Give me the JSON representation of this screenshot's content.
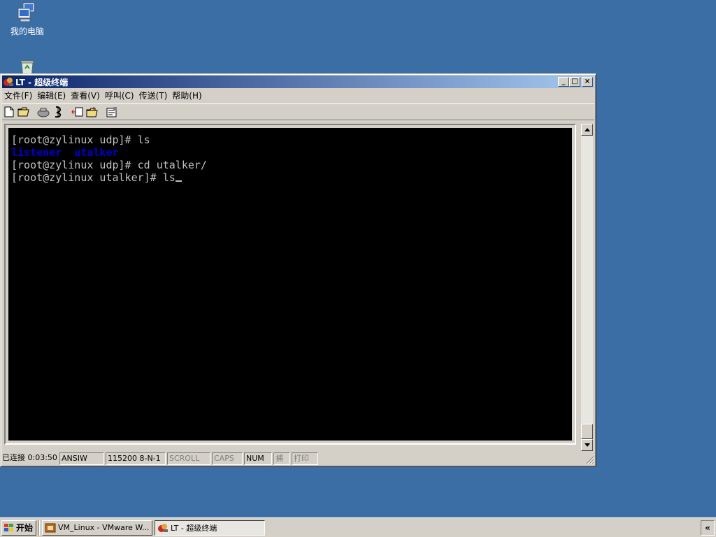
{
  "desktop": {
    "icons": [
      {
        "label": "我的电脑",
        "icon": "my-computer-icon"
      },
      {
        "label": "",
        "icon": "recycle-bin-icon"
      }
    ]
  },
  "window": {
    "title": "LT - 超级终端",
    "icon": "hyperterminal-icon",
    "controls": {
      "minimize": "_",
      "maximize": "□",
      "close": "×"
    },
    "menu": [
      {
        "label": "文件(F)"
      },
      {
        "label": "编辑(E)"
      },
      {
        "label": "查看(V)"
      },
      {
        "label": "呼叫(C)"
      },
      {
        "label": "传送(T)"
      },
      {
        "label": "帮助(H)"
      }
    ],
    "toolbar": [
      {
        "icon": "new-document-icon"
      },
      {
        "icon": "open-folder-icon"
      },
      {
        "icon": "call-icon"
      },
      {
        "icon": "disconnect-icon"
      },
      {
        "icon": "send-icon"
      },
      {
        "icon": "receive-icon"
      },
      {
        "icon": "properties-icon"
      }
    ]
  },
  "terminal": {
    "lines": [
      {
        "text": "[root@zylinux udp]# ls"
      },
      {
        "parts": [
          "listener",
          "utalker"
        ]
      },
      {
        "text": "[root@zylinux udp]# cd utalker/"
      },
      {
        "text": "[root@zylinux utalker]# ls"
      }
    ],
    "colors": {
      "background": "#000000",
      "text": "#c0c0c0",
      "directory": "#0000c8"
    }
  },
  "statusbar": {
    "connection": "已连接 0:03:50",
    "emulation": "ANSIW",
    "port_settings": "115200 8-N-1",
    "scroll": "SCROLL",
    "caps": "CAPS",
    "num": "NUM",
    "capture": "捕",
    "print": "打印"
  },
  "taskbar": {
    "start_label": "开始",
    "tasks": [
      {
        "label": "VM_Linux - VMware W...",
        "icon": "vmware-icon",
        "active": false
      },
      {
        "label": "LT - 超级终端",
        "icon": "hyperterminal-icon",
        "active": true
      }
    ],
    "tray_toggle": "«"
  }
}
